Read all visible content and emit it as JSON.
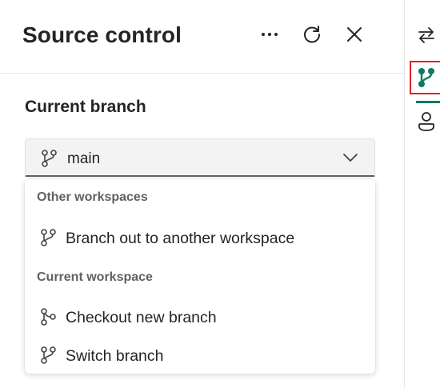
{
  "panel": {
    "title": "Source control",
    "section_title": "Current branch"
  },
  "branch_dropdown": {
    "selected": "main"
  },
  "menu": {
    "groups": [
      {
        "label": "Other workspaces",
        "items": [
          {
            "label": "Branch out to another workspace"
          }
        ]
      },
      {
        "label": "Current workspace",
        "items": [
          {
            "label": "Checkout new branch"
          },
          {
            "label": "Switch branch"
          }
        ]
      }
    ]
  },
  "icons": {
    "more": "more-horizontal-icon",
    "refresh": "refresh-icon",
    "close": "close-icon",
    "branch": "branch-icon",
    "branch_fork": "branch-fork-icon",
    "chevron": "chevron-down-icon",
    "swap": "arrow-swap-icon",
    "source_control": "source-control-icon",
    "person": "person-icon"
  },
  "colors": {
    "accent": "#117865",
    "highlight_border": "#e0202a",
    "text": "#242424",
    "muted_text": "#616161"
  }
}
